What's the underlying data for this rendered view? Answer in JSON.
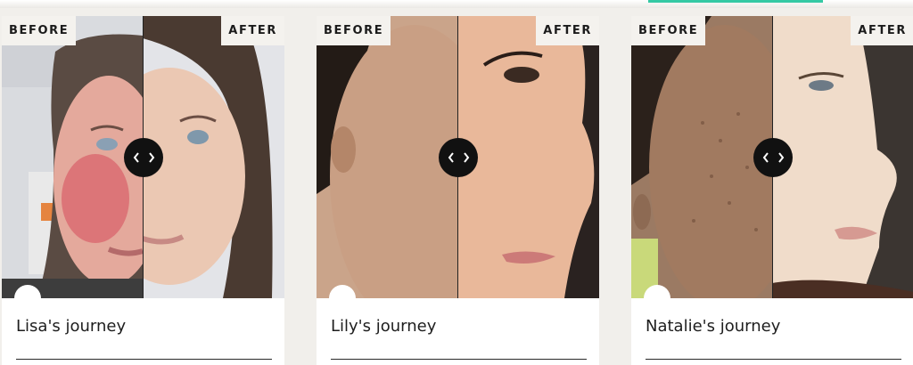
{
  "header": {
    "accent_color": "#35c9a4"
  },
  "cards": [
    {
      "before_label": "BEFORE",
      "after_label": "AFTER",
      "title": "Lisa's journey"
    },
    {
      "before_label": "BEFORE",
      "after_label": "AFTER",
      "title": "Lily's journey"
    },
    {
      "before_label": "BEFORE",
      "after_label": "AFTER",
      "title": "Natalie's journey"
    }
  ],
  "icons": {
    "slider_handle": "chevron-left-right-icon",
    "indicator": "circle-dot-icon"
  }
}
